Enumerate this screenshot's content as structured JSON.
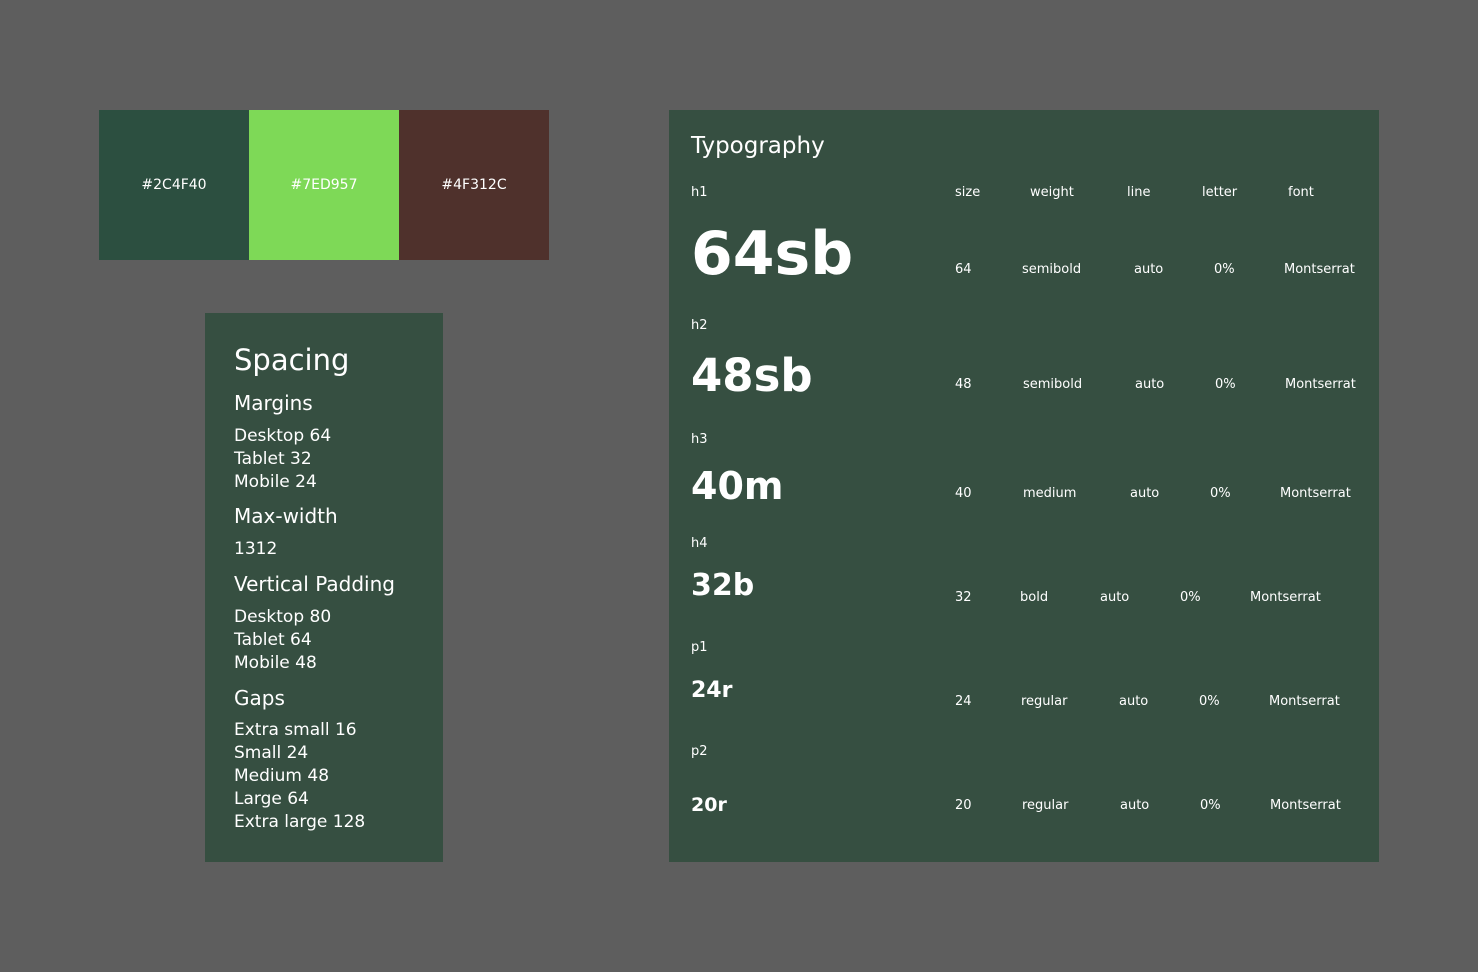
{
  "palette": [
    {
      "hex": "#2C4F40",
      "label": "#2C4F40"
    },
    {
      "hex": "#7ED957",
      "label": "#7ED957"
    },
    {
      "hex": "#4F312C",
      "label": "#4F312C"
    }
  ],
  "spacing": {
    "title": "Spacing",
    "margins": {
      "heading": "Margins",
      "items": [
        "Desktop 64",
        "Tablet 32",
        "Mobile 24"
      ]
    },
    "max_width": {
      "heading": "Max-width",
      "items": [
        "1312"
      ]
    },
    "vertical_padding": {
      "heading": "Vertical Padding",
      "items": [
        "Desktop 80",
        "Tablet 64",
        "Mobile 48"
      ]
    },
    "gaps": {
      "heading": "Gaps",
      "items": [
        "Extra small 16",
        "Small 24",
        "Medium 48",
        "Large 64",
        "Extra large 128"
      ]
    }
  },
  "typography": {
    "title": "Typography",
    "columns": [
      "size",
      "weight",
      "line",
      "letter",
      "font"
    ],
    "styles": [
      {
        "tag": "h1",
        "sample": "64sb",
        "size": "64",
        "weight": "semibold",
        "line": "auto",
        "letter": "0%",
        "font": "Montserrat"
      },
      {
        "tag": "h2",
        "sample": "48sb",
        "size": "48",
        "weight": "semibold",
        "line": "auto",
        "letter": "0%",
        "font": "Montserrat"
      },
      {
        "tag": "h3",
        "sample": "40m",
        "size": "40",
        "weight": "medium",
        "line": "auto",
        "letter": "0%",
        "font": "Montserrat"
      },
      {
        "tag": "h4",
        "sample": "32b",
        "size": "32",
        "weight": "bold",
        "line": "auto",
        "letter": "0%",
        "font": "Montserrat"
      },
      {
        "tag": "p1",
        "sample": "24r",
        "size": "24",
        "weight": "regular",
        "line": "auto",
        "letter": "0%",
        "font": "Montserrat"
      },
      {
        "tag": "p2",
        "sample": "20r",
        "size": "20",
        "weight": "regular",
        "line": "auto",
        "letter": "0%",
        "font": "Montserrat"
      }
    ]
  }
}
